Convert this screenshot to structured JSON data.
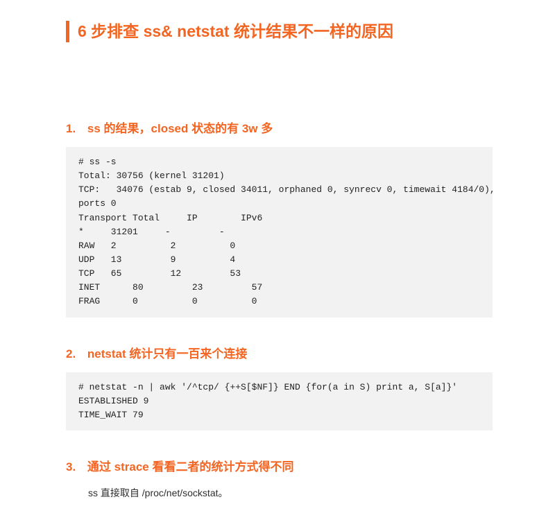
{
  "title": "6 步排查 ss& netstat 统计结果不一样的原因",
  "sections": [
    {
      "num": "1.",
      "heading": " ss 的结果，closed 状态的有 3w 多",
      "code": "# ss -s\nTotal: 30756 (kernel 31201)\nTCP:   34076 (estab 9, closed 34011, orphaned 0, synrecv 0, timewait 4184/0),\nports 0\nTransport Total     IP        IPv6\n*     31201     -         -\nRAW   2          2          0\nUDP   13         9          4\nTCP   65         12         53\nINET      80         23         57\nFRAG      0          0          0"
    },
    {
      "num": "2.",
      "heading": " netstat 统计只有一百来个连接",
      "code": "# netstat -n | awk '/^tcp/ {++S[$NF]} END {for(a in S) print a, S[a]}'\nESTABLISHED 9\nTIME_WAIT 79"
    },
    {
      "num": "3.",
      "heading": " 通过 strace 看看二者的统计方式得不同",
      "body": "ss 直接取自 /proc/net/sockstat。"
    }
  ]
}
